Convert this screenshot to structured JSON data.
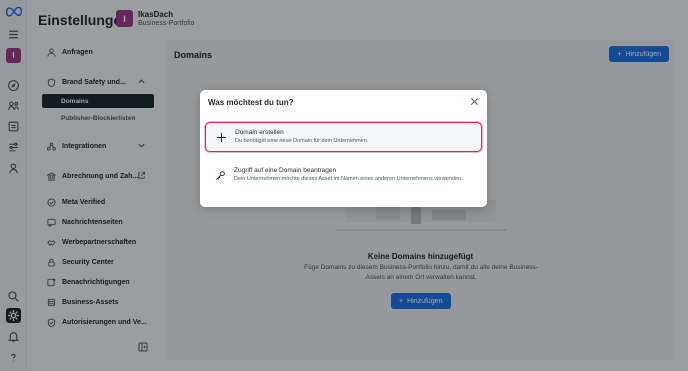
{
  "header": {
    "title": "Einstellungen",
    "business_initial": "I",
    "business_name": "IkasDach",
    "business_type": "Business-Portfolio"
  },
  "rail": {
    "account_initial": "I",
    "icons": [
      "meta-logo-icon",
      "menu-icon",
      "account-icon",
      "compass-icon",
      "people-icon",
      "pages-icon",
      "tools-icon",
      "analytics-icon",
      "search-icon",
      "settings-icon",
      "bell-icon",
      "help-icon"
    ]
  },
  "nav": {
    "requests": "Anfragen",
    "brand_safety": "Brand Safety und...",
    "domains": "Domains",
    "publisher_blocklists": "Publisher-Blockierlisten",
    "integrations": "Integrationen",
    "billing": "Abrechnung und Zah...",
    "meta_verified": "Meta Verified",
    "notification_pages": "Nachrichtenseiten",
    "partnerships": "Werbepartnerschaften",
    "security_center": "Security Center",
    "notifications": "Benachrichtigungen",
    "business_assets": "Business-Assets",
    "authorizations": "Autorisierungen und Ve..."
  },
  "main": {
    "title": "Domains",
    "add_label": "Hinzufügen",
    "empty_title": "Keine Domains hinzugefügt",
    "empty_desc": "Füge Domains zu diesem Business-Portfolio hinzu, damit du alle deine Business-Assets an einem Ort verwalten kannst."
  },
  "modal": {
    "title": "Was möchtest du tun?",
    "options": [
      {
        "label": "Domain erstellen",
        "desc": "Du benötigst eine neue Domain für dein Unternehmen.",
        "icon": "plus-icon",
        "selected": true
      },
      {
        "label": "Zugriff auf eine Domain beantragen",
        "desc": "Dein Unternehmen möchte dieses Asset im Namen eines anderen Unternehmens verwenden.",
        "icon": "key-icon",
        "selected": false
      }
    ]
  },
  "colors": {
    "primary": "#1b74e4",
    "highlight": "#e0245e",
    "dark": "#1c2b33",
    "avatar": "#9b3d8a"
  }
}
